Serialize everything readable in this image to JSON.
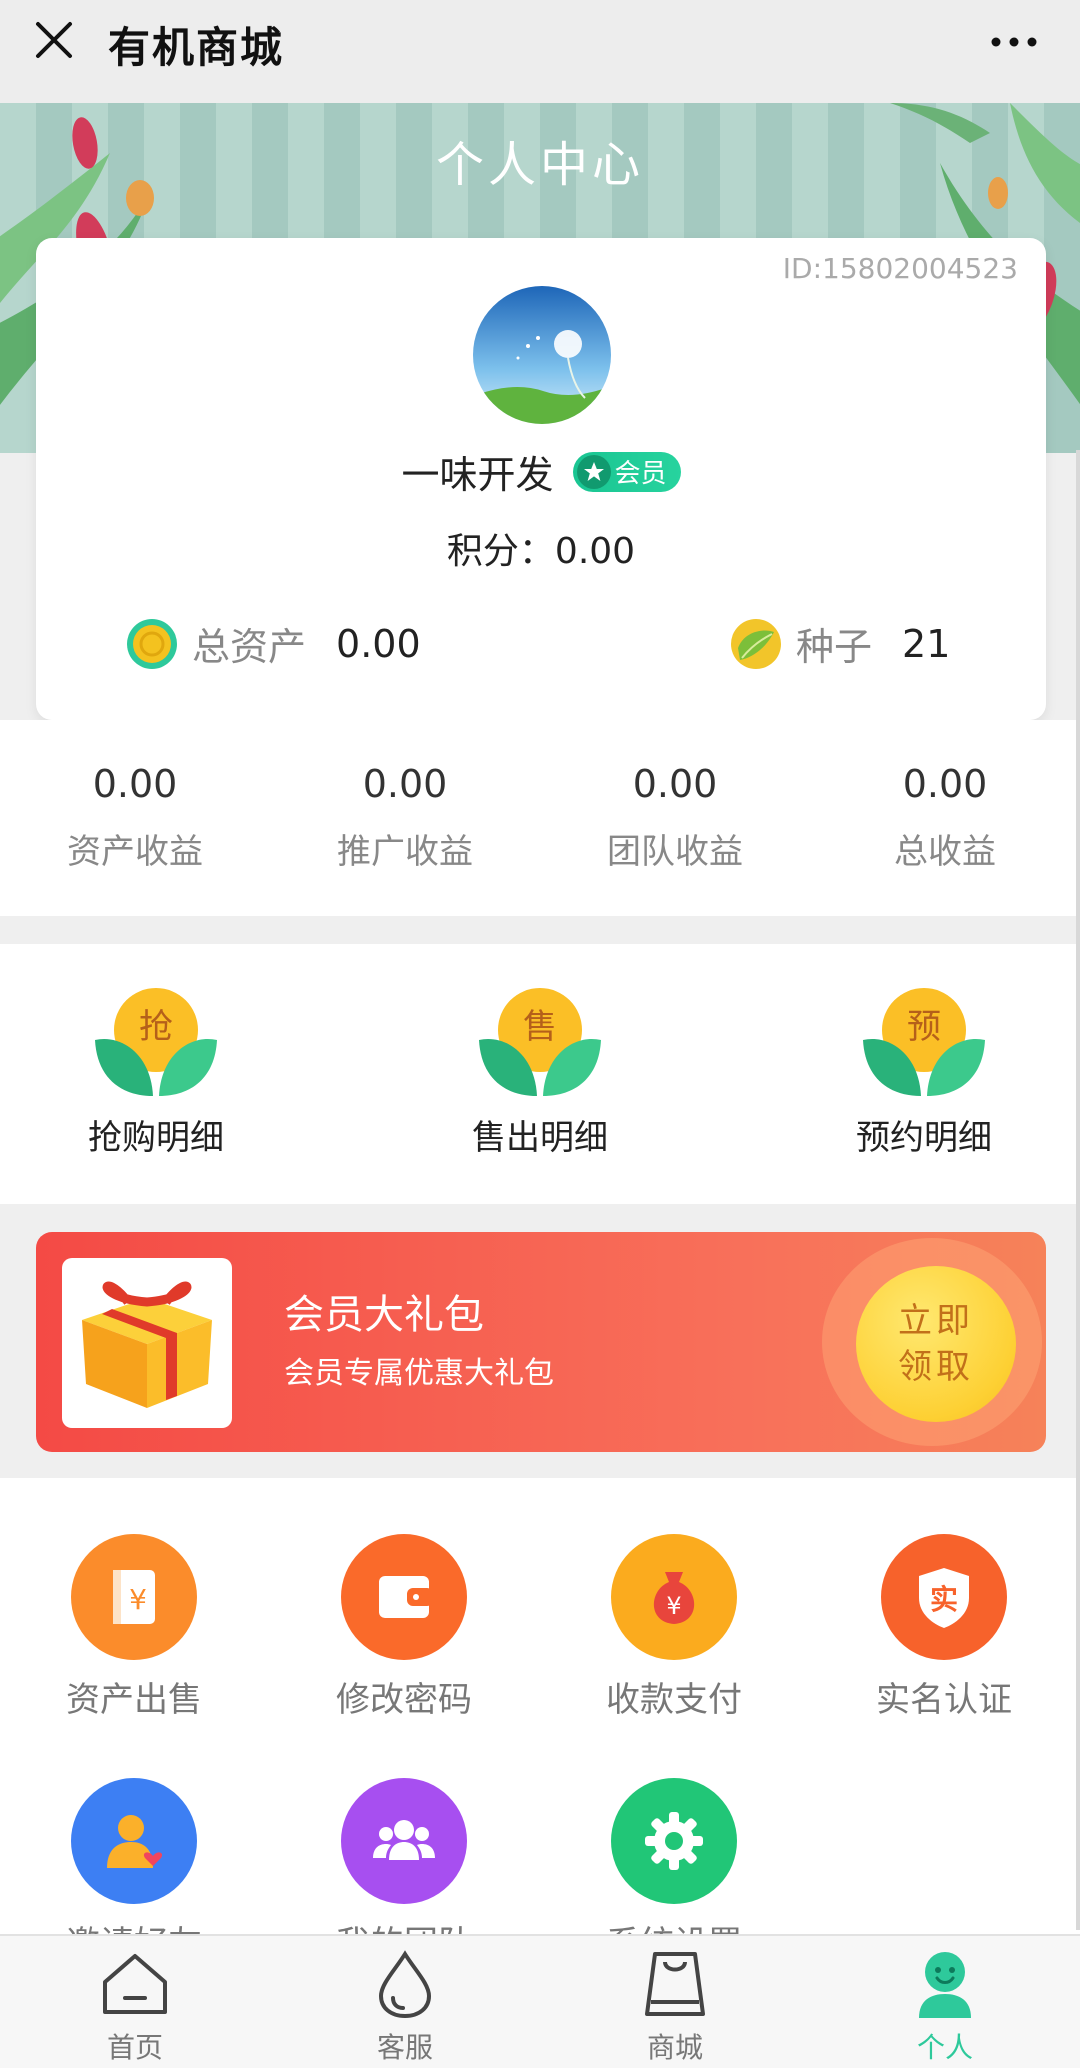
{
  "topbar": {
    "title": "有机商城"
  },
  "header": {
    "page_title": "个人中心"
  },
  "profile": {
    "id_text": "ID:15802004523",
    "username": "一味开发",
    "badge": "会员",
    "points_label": "积分：",
    "points_value": "0.00",
    "total_assets_label": "总资产",
    "total_assets_value": "0.00",
    "seeds_label": "种子",
    "seeds_value": "21"
  },
  "earnings": [
    {
      "value": "0.00",
      "label": "资产收益"
    },
    {
      "value": "0.00",
      "label": "推广收益"
    },
    {
      "value": "0.00",
      "label": "团队收益"
    },
    {
      "value": "0.00",
      "label": "总收益"
    }
  ],
  "records": [
    {
      "char": "抢",
      "label": "抢购明细"
    },
    {
      "char": "售",
      "label": "售出明细"
    },
    {
      "char": "预",
      "label": "预约明细"
    }
  ],
  "gift": {
    "title": "会员大礼包",
    "subtitle": "会员专属优惠大礼包",
    "button_line1": "立即",
    "button_line2": "领取"
  },
  "menu": [
    {
      "label": "资产出售",
      "icon": "yen-book-icon",
      "color": "#fb8c2b",
      "glyph": "¥"
    },
    {
      "label": "修改密码",
      "icon": "wallet-icon",
      "color": "#fa6a2a",
      "glyph": ""
    },
    {
      "label": "收款支付",
      "icon": "money-bag-icon",
      "color": "#fbab1e",
      "glyph": "¥"
    },
    {
      "label": "实名认证",
      "icon": "verify-shield-icon",
      "color": "#f7622b",
      "glyph": "实"
    },
    {
      "label": "邀请好友",
      "icon": "invite-user-icon",
      "color": "#3d7ff3",
      "glyph": ""
    },
    {
      "label": "我的团队",
      "icon": "team-icon",
      "color": "#a74ff0",
      "glyph": ""
    },
    {
      "label": "系统设置",
      "icon": "gear-icon",
      "color": "#21c677",
      "glyph": ""
    }
  ],
  "tabbar": [
    {
      "label": "首页",
      "icon": "home-icon",
      "active": false
    },
    {
      "label": "客服",
      "icon": "droplet-icon",
      "active": false
    },
    {
      "label": "商城",
      "icon": "shopping-bag-icon",
      "active": false
    },
    {
      "label": "个人",
      "icon": "person-icon",
      "active": true
    }
  ],
  "colors": {
    "accent": "#2ec99b",
    "banner_red": "#f44a45",
    "claim_yellow": "#fdd033"
  }
}
